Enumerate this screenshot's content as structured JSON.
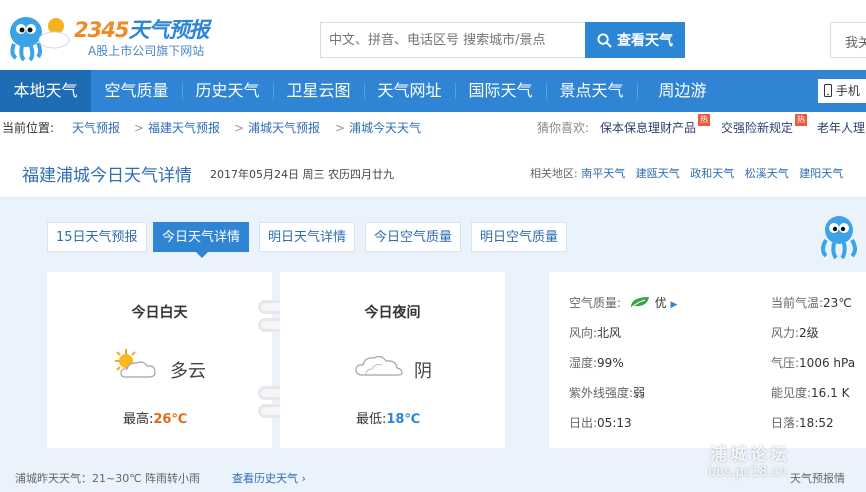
{
  "brand": {
    "logo_text_a": "2345",
    "logo_text_b": "天气预报",
    "subtitle": "A股上市公司旗下网站"
  },
  "search": {
    "placeholder": "中文、拼音、电话区号 搜索城市/景点",
    "button": "查看天气"
  },
  "header": {
    "login": "我关"
  },
  "nav": {
    "items": [
      "本地天气",
      "空气质量",
      "历史天气",
      "卫星云图",
      "天气网址",
      "国际天气",
      "景点天气",
      "周边游"
    ],
    "mobile": "手机"
  },
  "breadcrumb": {
    "label": "当前位置:",
    "items": [
      "天气预报",
      "福建天气预报",
      "浦城天气预报",
      "浦城今天天气"
    ],
    "sep": ">"
  },
  "ads": {
    "label": "猜你喜欢:",
    "items": [
      "保本保息理财产品",
      "交强险新规定",
      "老年人理"
    ],
    "hot": "热"
  },
  "page": {
    "title": "福建浦城今日天气详情",
    "date": "2017年05月24日 周三 农历四月廿九"
  },
  "related": {
    "label": "相关地区:",
    "items": [
      "南平天气",
      "建瓯天气",
      "政和天气",
      "松溪天气",
      "建阳天气"
    ]
  },
  "tabs": [
    "15日天气预报",
    "今日天气详情",
    "明日天气详情",
    "今日空气质量",
    "明日空气质量"
  ],
  "day": {
    "title": "今日白天",
    "condition": "多云",
    "temp_label": "最高:",
    "temp": "26℃",
    "temp_color": "#e06a1a"
  },
  "night": {
    "title": "今日夜间",
    "condition": "阴",
    "temp_label": "最低:",
    "temp": "18℃",
    "temp_color": "#2e86d6"
  },
  "details": {
    "aqi_label": "空气质量:",
    "aqi": "优",
    "wind_dir_label": "风向:",
    "wind_dir": "北风",
    "humidity_label": "湿度:",
    "humidity": "99%",
    "uv_label": "紫外线强度:",
    "uv": "弱",
    "sunrise_label": "日出:",
    "sunrise": "05:13",
    "cur_temp_label": "当前气温:",
    "cur_temp": "23℃",
    "wind_level_label": "风力:",
    "wind_level": "2级",
    "pressure_label": "气压:",
    "pressure": "1006 hPa",
    "visibility_label": "能见度:",
    "visibility": "16.1 K",
    "sunset_label": "日落:",
    "sunset": "18:52"
  },
  "footer": {
    "yesterday": "浦城昨天天气：21~30℃ 阵雨转小雨",
    "history_link": "查看历史天气"
  },
  "watermark": {
    "line1": "浦城论坛",
    "line2": "bbs.pc18.cn",
    "note": "天气预报情"
  },
  "colors": {
    "primary": "#2f85d3",
    "nav_active": "#1e6cb4",
    "link": "#2e6db4",
    "card_bg": "#eaf3fb",
    "warm": "#e06a1a",
    "cool": "#2e86d6"
  },
  "icons": [
    "logo-mascot-icon",
    "search-icon",
    "mobile-icon",
    "partly-cloudy-icon",
    "cloudy-icon",
    "leaf-icon",
    "mascot-icon"
  ]
}
